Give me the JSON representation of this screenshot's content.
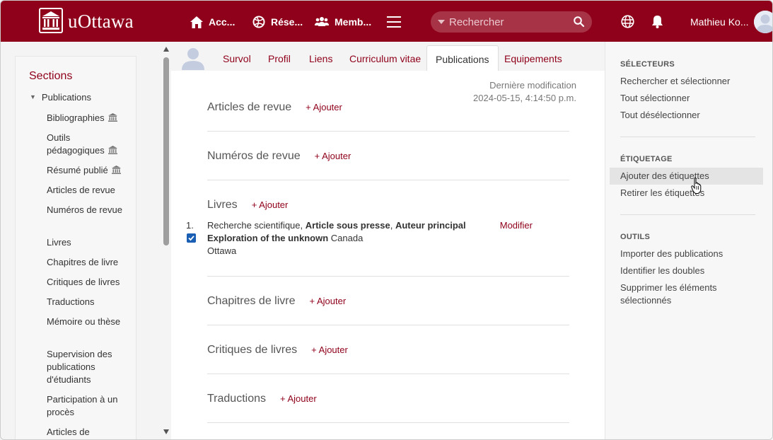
{
  "topbar": {
    "brand": "uOttawa",
    "nav": [
      {
        "label": "Acc...",
        "icon": "home-icon"
      },
      {
        "label": "Rése...",
        "icon": "network-globe-icon"
      },
      {
        "label": "Memb...",
        "icon": "members-icon"
      }
    ],
    "search_placeholder": "Rechercher",
    "user_name": "Mathieu Ko..."
  },
  "sidebar": {
    "title": "Sections",
    "root": "Publications",
    "items": [
      {
        "label": "Bibliographies",
        "inst": true
      },
      {
        "label": "Outils pédagogiques",
        "inst": true
      },
      {
        "label": "Résumé publié",
        "inst": true
      },
      {
        "label": "Articles de revue"
      },
      {
        "label": "Numéros de revue"
      },
      {
        "label": "Livres"
      },
      {
        "label": "Chapitres de livre"
      },
      {
        "label": "Critiques de livres"
      },
      {
        "label": "Traductions"
      },
      {
        "label": "Mémoire ou thèse"
      },
      {
        "label": "Supervision des publications d'étudiants"
      },
      {
        "label": "Participation à un procès"
      },
      {
        "label": "Articles de"
      }
    ]
  },
  "tabs": [
    {
      "label": "Survol"
    },
    {
      "label": "Profil"
    },
    {
      "label": "Liens"
    },
    {
      "label": "Curriculum vitae"
    },
    {
      "label": "Publications",
      "active": true
    },
    {
      "label": "Equipements"
    }
  ],
  "last_modified": {
    "label": "Dernière modification",
    "value": "2024-05-15, 4:14:50 p.m."
  },
  "add_label": "+ Ajouter",
  "sections": [
    {
      "title": "Articles de revue"
    },
    {
      "title": "Numéros de revue"
    },
    {
      "title": "Livres"
    },
    {
      "title": "Chapitres de livre"
    },
    {
      "title": "Critiques de livres"
    },
    {
      "title": "Traductions"
    }
  ],
  "publication": {
    "number": "1.",
    "type": "Recherche scientifique,",
    "status": "Article sous presse",
    "sep": ",",
    "role": "Auteur principal",
    "title": "Exploration of the unknown",
    "country": "Canada",
    "city": "Ottawa",
    "edit_label": "Modifier",
    "checked": true
  },
  "right_panel": {
    "groups": [
      {
        "heading": "SÉLECTEURS",
        "items": [
          "Rechercher et sélectionner",
          "Tout sélectionner",
          "Tout désélectionner"
        ]
      },
      {
        "heading": "ÉTIQUETAGE",
        "items": [
          "Ajouter des étiquettes",
          "Retirer les étiquettes"
        ]
      },
      {
        "heading": "OUTILS",
        "items": [
          "Importer des publications",
          "Identifier les doubles",
          "Supprimer les éléments sélectionnés"
        ]
      }
    ]
  },
  "colors": {
    "brand": "#8f001a",
    "checkbox": "#1a5fb4"
  }
}
